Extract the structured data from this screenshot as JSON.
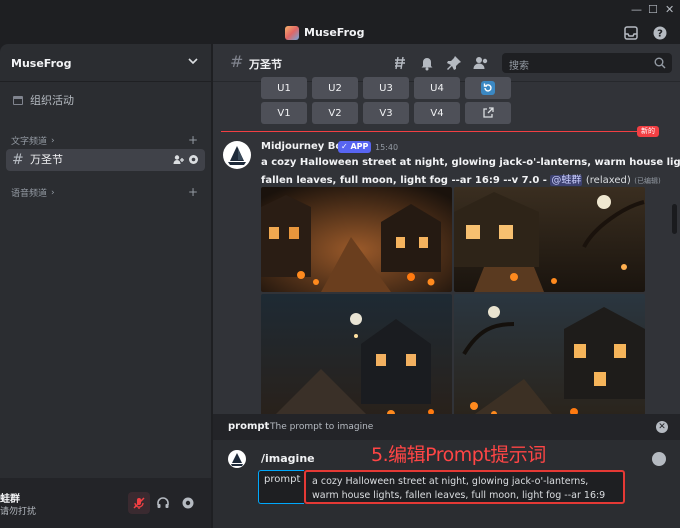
{
  "titlebar": {
    "app_title": "MuseFrog"
  },
  "sidebar": {
    "server_name": "MuseFrog",
    "events_label": "组织活动",
    "text_category": "文字频道",
    "voice_category": "语音频道",
    "active_channel": "万圣节"
  },
  "userbar": {
    "name": "蛙群",
    "status": "请勿打扰"
  },
  "channel": {
    "name": "万圣节",
    "search_placeholder": "搜索"
  },
  "buttons_prev": {
    "row1": [
      "U1",
      "U2",
      "U3",
      "U4"
    ],
    "row2": [
      "V1",
      "V2",
      "V3",
      "V4"
    ]
  },
  "new_divider": "新的",
  "message": {
    "author": "Midjourney Bot",
    "app_tag": "✓ APP",
    "time": "15:40",
    "line1": "a cozy Halloween street at night, glowing jack-o'-lanterns, warm house lights,",
    "line2": "fallen leaves, full moon, light fog --ar 16:9 --v 7.0 -",
    "mention": "@蛙群",
    "relaxed": "(relaxed)",
    "edited": "(已编辑)"
  },
  "command": {
    "option_name": "prompt",
    "option_desc": "The prompt to imagine",
    "name": "/imagine",
    "prompt_label": "prompt",
    "prompt_value": "a cozy Halloween street at night, glowing jack-o'-lanterns, warm house lights, fallen leaves, full moon, light fog --ar 16:9",
    "annotation": "5.编辑Prompt提示词"
  },
  "colors": {
    "accent": "#5865f2",
    "new_red": "#f23f43",
    "annotation_red": "#ff4545"
  }
}
